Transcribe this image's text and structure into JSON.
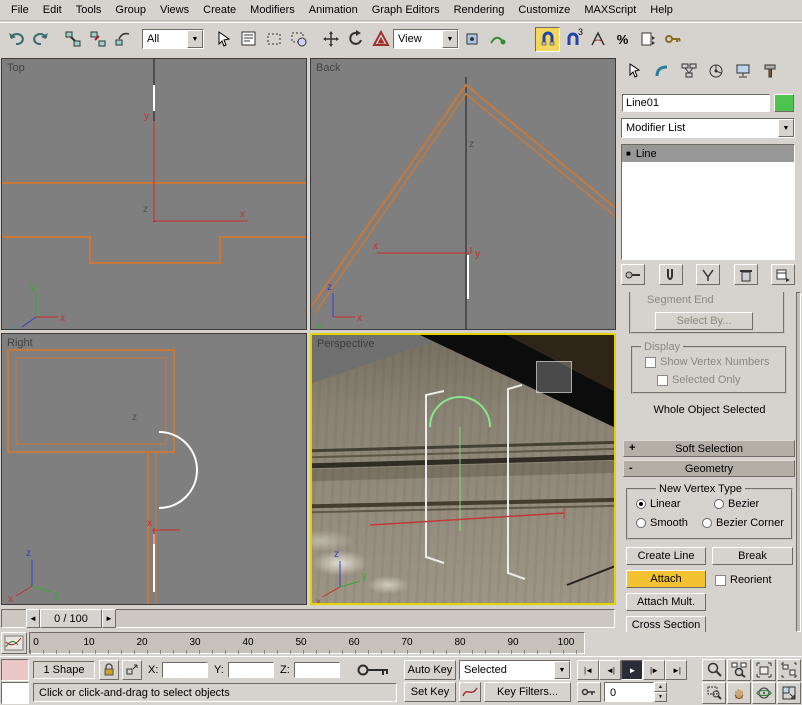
{
  "menubar": {
    "items": [
      "File",
      "Edit",
      "Tools",
      "Group",
      "Views",
      "Create",
      "Modifiers",
      "Animation",
      "Graph Editors",
      "Rendering",
      "Customize",
      "MAXScript",
      "Help"
    ]
  },
  "toolbar": {
    "filter_value": "All",
    "coord_value": "View",
    "snap_superscript": "3",
    "percent": "%"
  },
  "viewports": {
    "top": "Top",
    "back": "Back",
    "right": "Right",
    "perspective": "Perspective",
    "ax": {
      "x": "x",
      "y": "y",
      "z": "z"
    }
  },
  "panel": {
    "object_name": "Line01",
    "modifier_list": "Modifier List",
    "stack_item": "Line",
    "segment_end": "Segment End",
    "select_by": "Select By...",
    "display_group": "Display",
    "show_vertex_numbers": "Show Vertex Numbers",
    "selected_only": "Selected Only",
    "whole_object_selected": "Whole Object Selected",
    "soft_selection": "Soft Selection",
    "geometry": "Geometry",
    "new_vertex_type": "New Vertex Type",
    "linear": "Linear",
    "bezier": "Bezier",
    "smooth": "Smooth",
    "bezier_corner": "Bezier Corner",
    "create_line": "Create Line",
    "break_btn": "Break",
    "attach": "Attach",
    "reorient": "Reorient",
    "attach_mult": "Attach Mult.",
    "cross_section": "Cross Section",
    "colors": {
      "object_swatch": "#4ec44e",
      "attach_active": "#f2c230",
      "spline_orange": "#c8793a",
      "arc_green": "#86e886",
      "active_viewport": "#e3d400"
    }
  },
  "time_slider": {
    "value": "0 / 100"
  },
  "timeline": {
    "ticks": [
      "0",
      "10",
      "20",
      "30",
      "40",
      "50",
      "60",
      "70",
      "80",
      "90",
      "100"
    ]
  },
  "status": {
    "selection_count": "1 Shape",
    "x_label": "X:",
    "y_label": "Y:",
    "z_label": "Z:",
    "x_value": "",
    "y_value": "",
    "z_value": "",
    "prompt": "Click or click-and-drag to select objects",
    "auto_key": "Auto Key",
    "set_key": "Set Key",
    "key_mode": "Selected",
    "key_filters": "Key Filters...",
    "frame_value": "0",
    "transport": {
      "start": "|◄",
      "prev": "◄|",
      "play": "►",
      "next": "|►",
      "end": "►|"
    }
  },
  "glyphs": {
    "dropdown": "▼",
    "up": "▲",
    "down": "▼",
    "left": "◄",
    "right": "►",
    "plus": "+",
    "minus": "-",
    "square": "■"
  }
}
